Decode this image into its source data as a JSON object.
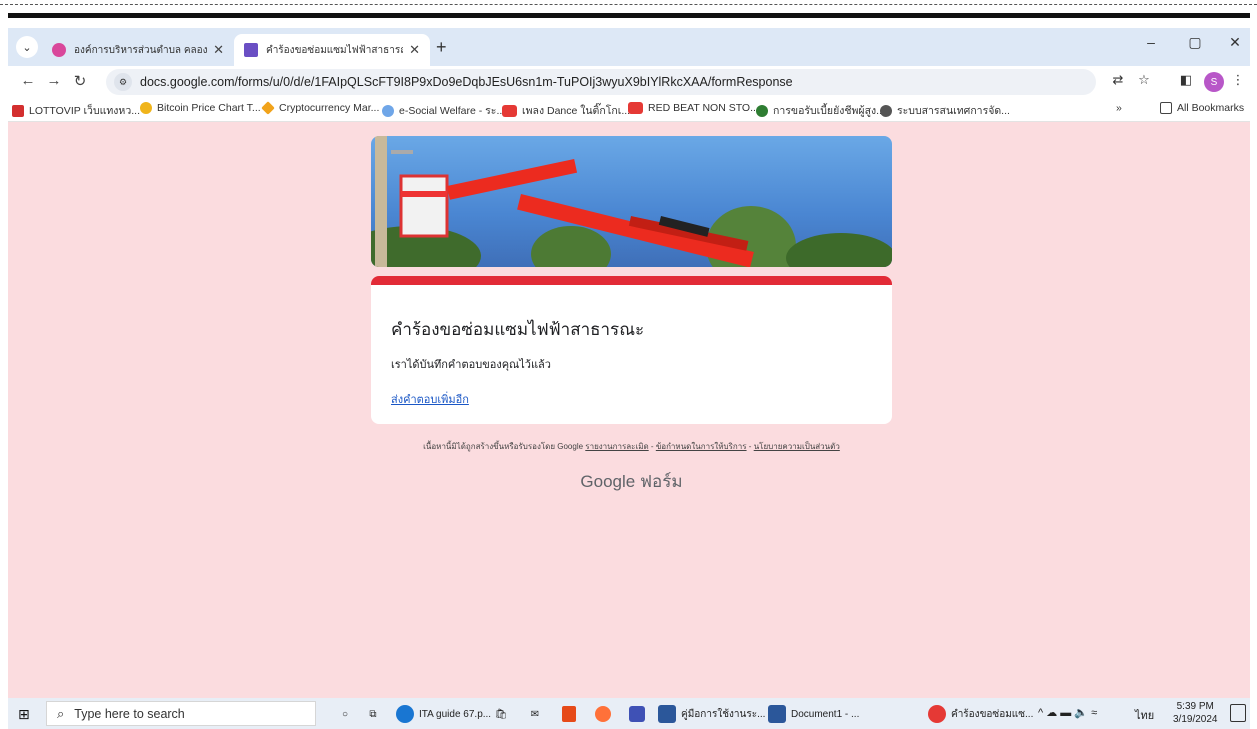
{
  "tabs": [
    {
      "label": "องค์การบริหารส่วนตำบล คลองครามะ",
      "color": "#d9479b"
    },
    {
      "label": "คำร้องขอซ่อมแซมไฟฟ้าสาธารณะ",
      "color": "#6a4fc4"
    }
  ],
  "address": {
    "url": "docs.google.com/forms/u/0/d/e/1FAIpQLScFT9I8P9xDo9eDqbJEsU6sn1m-TuPOIj3wyuX9bIYlRkcXAA/formResponse"
  },
  "profile_initial": "S",
  "bookmarks": [
    {
      "label": "LOTTOVIP เว็บแทงหว...",
      "color": "#d32f2f"
    },
    {
      "label": "Bitcoin Price Chart T...",
      "color": "#f0b41b"
    },
    {
      "label": "Cryptocurrency Mar...",
      "color": "#f1a31b"
    },
    {
      "label": "e-Social Welfare - ระ...",
      "color": "#6fa6e8"
    },
    {
      "label": "เพลง Dance ในติ๊กโกเ...",
      "color": "#e53935"
    },
    {
      "label": "RED BEAT NON STO...",
      "color": "#e53935"
    },
    {
      "label": "การขอรับเบี้ยยังชีพผู้สูง...",
      "color": "#2e7d32"
    },
    {
      "label": "ระบบสารสนเทศการจัด...",
      "color": "#555555"
    }
  ],
  "bookmarks_more": "»",
  "all_bookmarks": "All Bookmarks",
  "form": {
    "title": "คำร้องขอซ่อมแซมไฟฟ้าสาธารณะ",
    "message": "เราได้บันทึกคำตอบของคุณไว้แล้ว",
    "submit_another": "ส่งคำตอบเพิ่มอีก",
    "accent_color": "#e22b37"
  },
  "footer": {
    "disclaimer": "เนื้อหานี้มิได้ถูกสร้างขึ้นหรือรับรองโดย Google",
    "report_abuse": "รายงานการละเมิด",
    "terms": "ข้อกำหนดในการให้บริการ",
    "privacy": "นโยบายความเป็นส่วนตัว",
    "separator": " - ",
    "brand_google": "Google",
    "brand_forms": "ฟอร์ม"
  },
  "taskbar": {
    "search_placeholder": "Type here to search",
    "items": [
      {
        "label": "ITA guide 67.p...",
        "color": "#1976d2"
      },
      {
        "label": "คู่มือการใช้งานระ...",
        "color": "#2b579a"
      },
      {
        "label": "Document1 - ...",
        "color": "#2b579a"
      },
      {
        "label": "คำร้องขอซ่อมแซ...",
        "color": "#e53935"
      }
    ],
    "language": "ไทย",
    "time": "5:39 PM",
    "date": "3/19/2024"
  }
}
